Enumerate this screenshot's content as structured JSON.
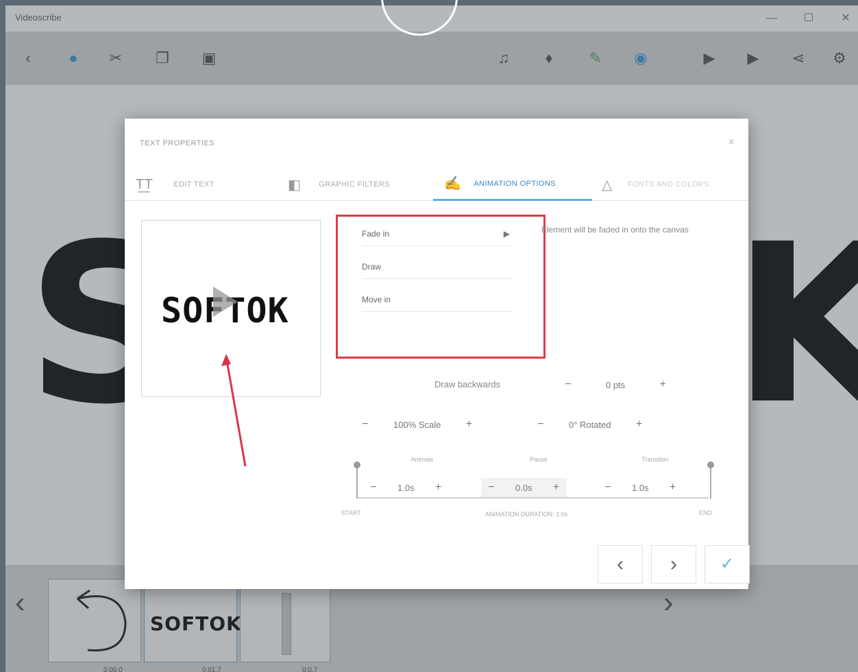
{
  "window": {
    "title": "Videoscribe",
    "minimize": "—",
    "maximize": "☐",
    "close": "✕"
  },
  "toolbar": {
    "left_icons": [
      "back-icon",
      "cursor-icon",
      "cut-icon",
      "copy-icon",
      "paste-icon"
    ],
    "right_icons": [
      "music-icon",
      "microphone-icon",
      "pen-icon",
      "color-icon",
      "play-from-here-icon",
      "play-icon",
      "share-icon",
      "settings-icon"
    ]
  },
  "canvas": {
    "text_left": "S",
    "text_right": "K"
  },
  "timeline": {
    "prev": "‹",
    "next": "›",
    "thumb_text": "SOFTOK",
    "durations": [
      "0:00.0",
      "0:01.7",
      "0:0.7"
    ]
  },
  "dialog": {
    "title": "TEXT PROPERTIES",
    "close": "×",
    "tabs": [
      {
        "label": "EDIT TEXT",
        "icon": "text-icon"
      },
      {
        "label": "GRAPHIC FILTERS",
        "icon": "filter-icon"
      },
      {
        "label": "ANIMATION OPTIONS",
        "icon": "hand-icon"
      },
      {
        "label": "FONTS AND COLORS",
        "icon": "font-icon"
      }
    ],
    "preview_text": "SOFTOK",
    "animation": {
      "options": [
        "Fade in",
        "Draw",
        "Move in"
      ],
      "selected": "Fade in",
      "description": "Element will be faded in onto the canvas"
    },
    "draw_backwards": {
      "label": "Draw backwards",
      "value": "0 pts"
    },
    "scale": {
      "value": "100% Scale"
    },
    "rotate": {
      "value": "0° Rotated"
    },
    "timing": {
      "segments": [
        {
          "label": "Animate",
          "value": "1.0s"
        },
        {
          "label": "Pause",
          "value": "0.0s"
        },
        {
          "label": "Transition",
          "value": "1.0s"
        }
      ],
      "start_label": "START",
      "end_label": "END",
      "center_label": "ANIMATION DURATION: 2.0s"
    },
    "buttons": {
      "prev": "‹",
      "next": "›",
      "ok": "✓"
    }
  }
}
